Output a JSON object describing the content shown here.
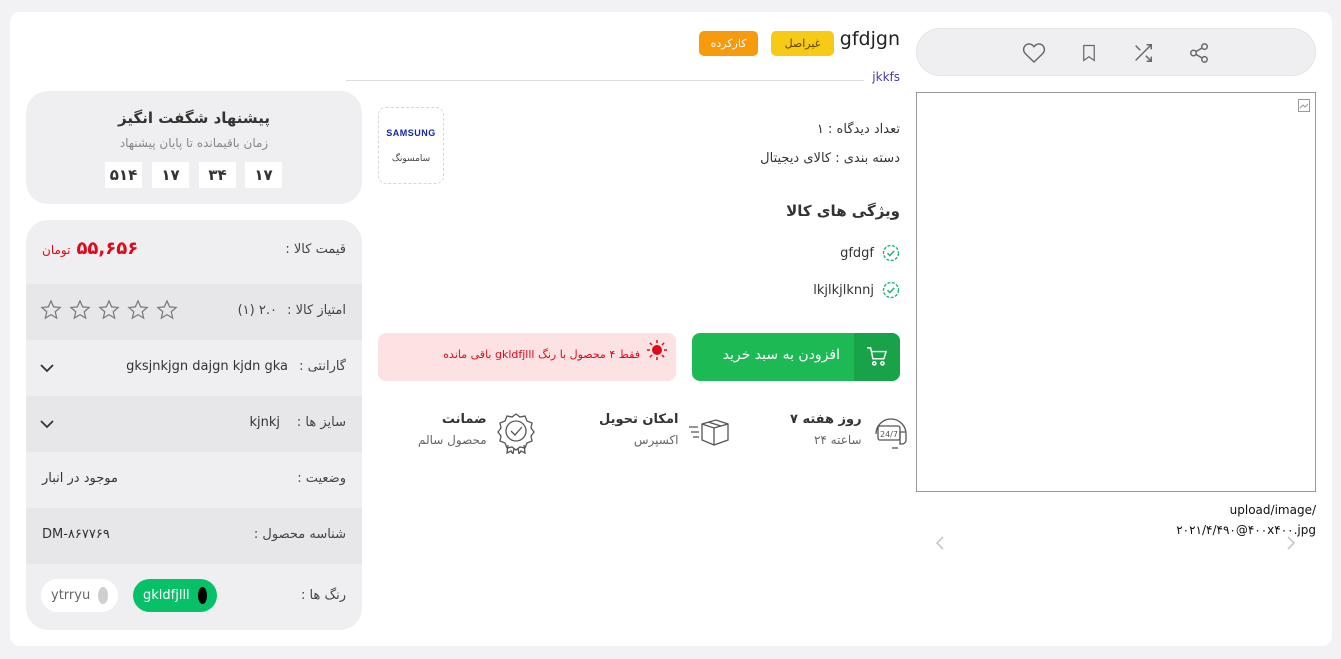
{
  "product": {
    "title": "gfdjgn",
    "subtitle": "jkkfs",
    "badges": {
      "original": "غیراصل",
      "used": "کارکرده"
    },
    "views": "تعداد دیدگاه :  ۱",
    "category": "دسته بندی : کالای دیجیتال",
    "brand": {
      "logo_text": "SAMSUNG",
      "name": "سامسونگ"
    },
    "features_heading": "ویژگی های کالا",
    "features": [
      "gfdgf",
      "lkjlkjlknnj"
    ],
    "image_caption": "upload/image/ ۲۰۲۱/۴/۴۹۰@۴۰۰x۴۰۰.jpg"
  },
  "actions": {
    "icons": [
      "share-icon",
      "shuffle-icon",
      "bookmark-icon",
      "heart-icon"
    ]
  },
  "cart": {
    "add_label": "افزودن به سبد خرید",
    "stock_warning": "فقط ۴ محصول با رنگ gkldfjlll باقی مانده"
  },
  "perks": [
    {
      "title": "۷ روز هفته",
      "subtitle": "۲۴ ساعته",
      "icon": "support-247-icon"
    },
    {
      "title": "امکان تحویل",
      "subtitle": "اکسپرس",
      "icon": "delivery-box-icon"
    },
    {
      "title": "ضمانت",
      "subtitle": "محصول سالم",
      "icon": "guarantee-badge-icon"
    }
  ],
  "offer": {
    "heading": "پیشنهاد شگفت انگیز",
    "subheading": "زمان باقیمانده تا پایان پیشنهاد",
    "timer": [
      "۱۷",
      "۳۴",
      "۱۷",
      "۵۱۴"
    ]
  },
  "details": {
    "price_label": "قیمت کالا :",
    "price_value": "۵۵,۶۵۶",
    "currency": "تومان",
    "rating_label": "امتیاز کالا :",
    "rating_value": "۲.۰ (۱)",
    "rating_stars": 0,
    "rating_max": 5,
    "warranty_label": "گارانتی :",
    "warranty_value": "gksjnkjgn dajgn kjdn gka",
    "size_label": "سایز ها :",
    "size_value": "kjnkj",
    "status_label": "وضعیت :",
    "status_value": "موجود در انبار",
    "sku_label": "شناسه محصول :",
    "sku_value": "DM-۸۶۷۷۶۹",
    "colors_label": "رنگ ها :",
    "colors": [
      {
        "name": "gkldfjlll",
        "hex": "#000000",
        "selected": true
      },
      {
        "name": "ytrryu",
        "hex": "#cfcfcf",
        "selected": false
      }
    ]
  },
  "colors": {
    "accent_green": "#1db954",
    "chip_selected": "#06c167",
    "price_red": "#e0091b",
    "badge_yellow": "#f7cb15",
    "badge_orange": "#f79a0b"
  }
}
